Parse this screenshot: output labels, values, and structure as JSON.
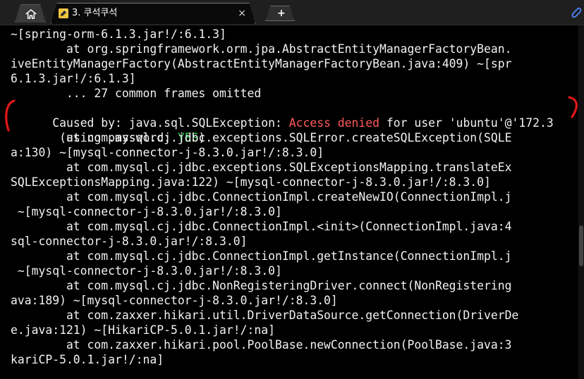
{
  "window": {
    "active_tab_title": "3. 쿠석쿠석",
    "tab_close": "×",
    "new_tab": "+"
  },
  "terminal": {
    "line1": "~[spring-orm-6.1.3.jar!/:6.1.3]",
    "line2": "        at org.springframework.orm.jpa.AbstractEntityManagerFactoryBean.",
    "line3": "iveEntityManagerFactory(AbstractEntityManagerFactoryBean.java:409) ~[spr",
    "line4": "6.1.3.jar!/:6.1.3]",
    "line5": "        ... 27 common frames omitted",
    "line6": {
      "before": "Caused by: java.sql.SQLException: ",
      "denied": "Access denied",
      "after": " for user 'ubuntu'@'172.3"
    },
    "line7": {
      "before": " (using password: ",
      "yes": "YES",
      "after": ")"
    },
    "line8": "        at com.mysql.cj.jdbc.exceptions.SQLError.createSQLException(SQLE",
    "line9": "a:130) ~[mysql-connector-j-8.3.0.jar!/:8.3.0]",
    "line10": "        at com.mysql.cj.jdbc.exceptions.SQLExceptionsMapping.translateEx",
    "line11": "SQLExceptionsMapping.java:122) ~[mysql-connector-j-8.3.0.jar!/:8.3.0]",
    "line12": "        at com.mysql.cj.jdbc.ConnectionImpl.createNewIO(ConnectionImpl.j",
    "line13": " ~[mysql-connector-j-8.3.0.jar!/:8.3.0]",
    "line14": "        at com.mysql.cj.jdbc.ConnectionImpl.<init>(ConnectionImpl.java:4",
    "line15": "sql-connector-j-8.3.0.jar!/:8.3.0]",
    "line16": "        at com.mysql.cj.jdbc.ConnectionImpl.getInstance(ConnectionImpl.j",
    "line17": " ~[mysql-connector-j-8.3.0.jar!/:8.3.0]",
    "line18": "        at com.mysql.cj.jdbc.NonRegisteringDriver.connect(NonRegistering",
    "line19": "ava:189) ~[mysql-connector-j-8.3.0.jar!/:8.3.0]",
    "line20": "        at com.zaxxer.hikari.util.DriverDataSource.getConnection(DriverDe",
    "line21": "e.java:121) ~[HikariCP-5.0.1.jar!/:na]",
    "line22": "        at com.zaxxer.hikari.pool.PoolBase.newConnection(PoolBase.java:3",
    "line23": "kariCP-5.0.1.jar!/:na]"
  },
  "colors": {
    "background": "#000000",
    "text": "#f2f2f2",
    "error_highlight": "#ff5a5a",
    "success_highlight": "#30d24b",
    "annotation": "#e01818",
    "tabbar": "#1f1f1f"
  },
  "icons": {
    "home": "home-icon",
    "tab": "pencil-icon",
    "attach": "paperclip-icon"
  }
}
